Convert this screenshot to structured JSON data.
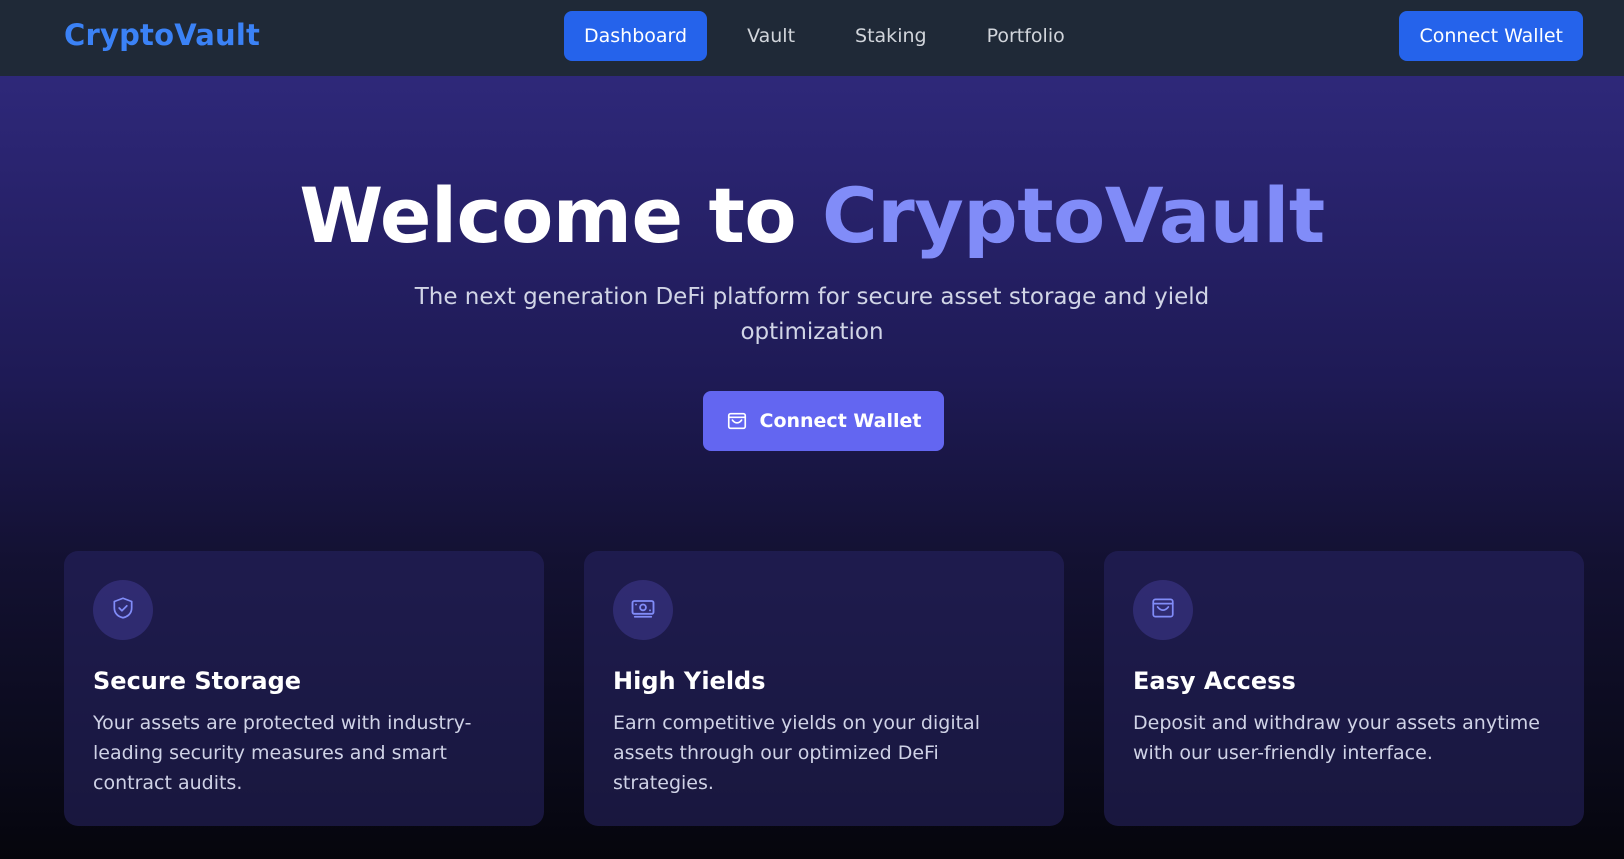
{
  "navbar": {
    "brand": "CryptoVault",
    "links": [
      {
        "label": "Dashboard",
        "active": true
      },
      {
        "label": "Vault",
        "active": false
      },
      {
        "label": "Staking",
        "active": false
      },
      {
        "label": "Portfolio",
        "active": false
      }
    ],
    "cta_label": "Connect Wallet"
  },
  "hero": {
    "title_prefix": "Welcome to",
    "title_accent": "CryptoVault",
    "subtitle": "The next generation DeFi platform for secure asset storage and yield optimization",
    "cta_label": "Connect Wallet",
    "cta_icon": "wallet-icon"
  },
  "features": [
    {
      "icon": "shield-check-icon",
      "title": "Secure Storage",
      "description": "Your assets are protected with industry-leading security measures and smart contract audits."
    },
    {
      "icon": "banknote-icon",
      "title": "High Yields",
      "description": "Earn competitive yields on your digital assets through our optimized DeFi strategies."
    },
    {
      "icon": "wallet-icon",
      "title": "Easy Access",
      "description": "Deposit and withdraw your assets anytime with our user-friendly interface."
    }
  ],
  "colors": {
    "navbar_bg": "#1f2937",
    "brand": "#3b82f6",
    "primary_button": "#2563eb",
    "hero_button": "#6366f1",
    "accent_text": "#818cf8"
  }
}
